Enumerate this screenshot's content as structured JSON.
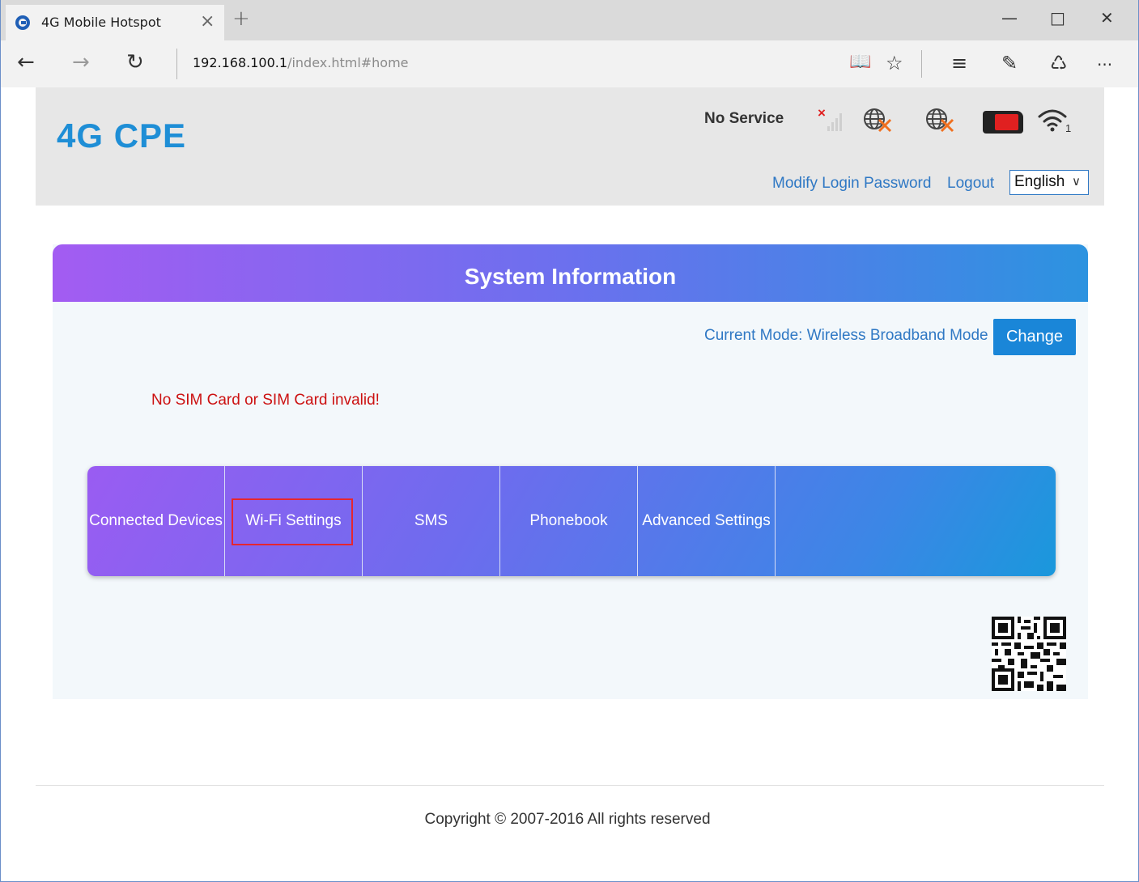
{
  "browser": {
    "tab_title": "4G Mobile Hotspot",
    "tab_close": "×",
    "new_tab": "+",
    "address_host": "192.168.100.1",
    "address_path": "/index.html#home",
    "window_controls": {
      "minimize": "—",
      "maximize": "□",
      "close": "✕"
    },
    "nav": {
      "back": "←",
      "forward": "→",
      "refresh": "↻"
    },
    "toolbar": {
      "reading": "📖",
      "favorite": "☆",
      "hub": "≡",
      "note": "✎",
      "share": "♺",
      "more": "···"
    }
  },
  "header": {
    "logo": "4G CPE",
    "network_status": "No Service",
    "signal_error_mark": "×",
    "wifi_clients": "1",
    "links": {
      "modify_password": "Modify Login Password",
      "logout": "Logout"
    },
    "language": "English"
  },
  "panel": {
    "title": "System Information",
    "current_mode": "Current Mode: Wireless Broadband Mode",
    "change_button": "Change",
    "sim_message": "No SIM Card or SIM Card invalid!",
    "menu": [
      {
        "label": "Connected Devices"
      },
      {
        "label": "Wi-Fi Settings"
      },
      {
        "label": "SMS"
      },
      {
        "label": "Phonebook"
      },
      {
        "label": "Advanced Settings"
      }
    ]
  },
  "footer": {
    "copyright": "Copyright © 2007-2016 All rights reserved"
  },
  "colors": {
    "accent": "#1a86d8",
    "logo": "#1e8ed6",
    "error": "#cc1111",
    "highlight": "#e5262f"
  }
}
